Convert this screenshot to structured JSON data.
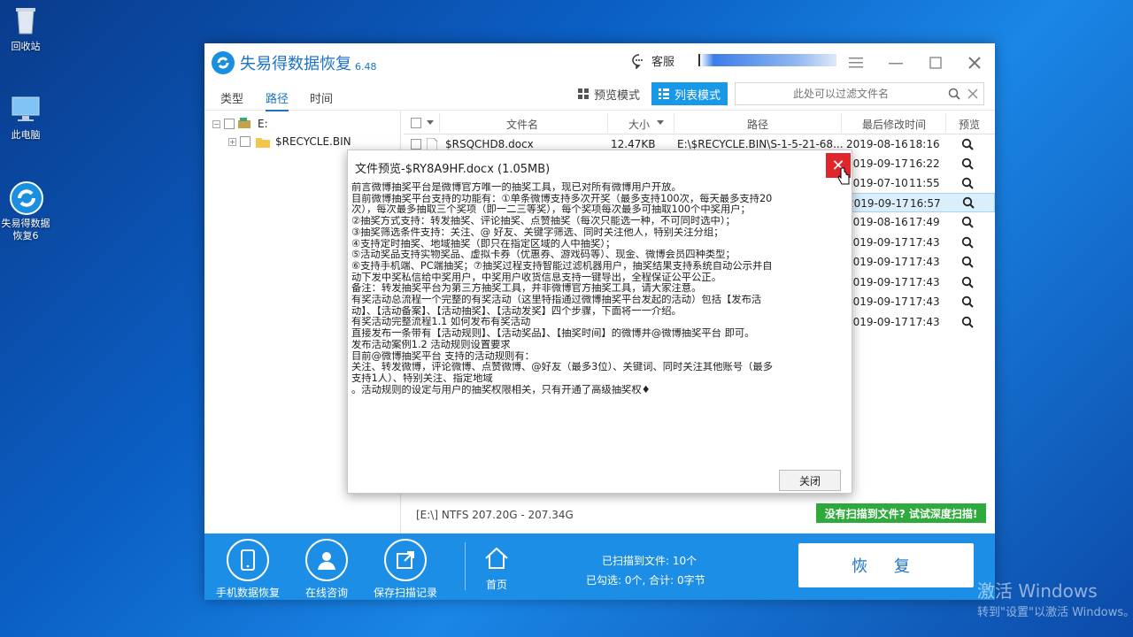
{
  "desktop": {
    "icons": [
      {
        "label": "回收站"
      },
      {
        "label": "此电脑"
      },
      {
        "label_line1": "失易得数据",
        "label_line2": "恢复6"
      }
    ],
    "watermark": {
      "line1": "激活 Windows",
      "line2": "转到\"设置\"以激活 Windows。"
    }
  },
  "app": {
    "name": "失易得数据恢复",
    "version": "6.48",
    "support_label": "客服"
  },
  "tabs": [
    {
      "label": "类型"
    },
    {
      "label": "路径"
    },
    {
      "label": "时间"
    }
  ],
  "view_modes": {
    "preview": "预览模式",
    "list": "列表模式"
  },
  "filter": {
    "placeholder": "此处可以过滤文件名"
  },
  "tree": {
    "drive": "E:",
    "child": "$RECYCLE.BIN"
  },
  "table": {
    "headers": {
      "name": "文件名",
      "size": "大小",
      "path": "路径",
      "modified": "最后修改时间",
      "preview": "预览"
    },
    "rows": [
      {
        "name": "$RSQCHD8.docx",
        "size": "12.47KB",
        "path": "E:\\$RECYCLE.BIN\\S-1-5-21-68...",
        "date": "2019-08-16",
        "time": "18:16"
      },
      {
        "name": "",
        "size": "",
        "path": "",
        "date": "2019-09-17",
        "time": "16:22"
      },
      {
        "name": "",
        "size": "",
        "path": "",
        "date": "2019-07-10",
        "time": "11:55"
      },
      {
        "name": "",
        "size": "",
        "path": "",
        "date": "2019-09-17",
        "time": "16:57"
      },
      {
        "name": "",
        "size": "",
        "path": "",
        "date": "2019-08-16",
        "time": "17:49"
      },
      {
        "name": "",
        "size": "",
        "path": "",
        "date": "2019-09-17",
        "time": "17:43"
      },
      {
        "name": "",
        "size": "",
        "path": "",
        "date": "2019-09-17",
        "time": "17:43"
      },
      {
        "name": "",
        "size": "",
        "path": "",
        "date": "2019-09-17",
        "time": "17:43"
      },
      {
        "name": "",
        "size": "",
        "path": "",
        "date": "2019-09-17",
        "time": "17:43"
      },
      {
        "name": "",
        "size": "",
        "path": "",
        "date": "2019-09-17",
        "time": "17:43"
      }
    ]
  },
  "status": {
    "disk": "[E:\\] NTFS 207.20G - 207.34G",
    "deep_scan": "没有扫描到文件? 试试深度扫描!"
  },
  "bottom": {
    "phone_recovery": "手机数据恢复",
    "consult": "在线咨询",
    "save_scan": "保存扫描记录",
    "home": "首页",
    "scanned": "已扫描到文件: 10个",
    "selected": "已勾选: 0个, 合计: 0字节",
    "recover": "恢 复"
  },
  "dialog": {
    "title": "文件预览-$RY8A9HF.docx (1.05MB)",
    "close_button": "关闭",
    "lines": [
      "前言微博抽奖平台是微博官方唯一的抽奖工具，现已对所有微博用户开放。",
      "目前微博抽奖平台支持的功能有：①单条微博支持多次开奖（最多支持100次，每天最多支持20",
      "次），每次最多抽取三个奖项（即一二三等奖），每个奖项每次最多可抽取100个中奖用户；",
      "②抽奖方式支持：转发抽奖、评论抽奖、点赞抽奖（每次只能选一种，不可同时选中）；",
      "③抽奖筛选条件支持：关注、@ 好友、关键字筛选、同时关注他人，特别关注分组；",
      "④支持定时抽奖、地域抽奖（即只在指定区域的人中抽奖）；",
      "⑤活动奖品支持实物奖品、虚拟卡券（优惠券、游戏码等）、现金、微博会员四种类型；",
      "⑥支持手机端、PC端抽奖；⑦抽奖过程支持智能过滤机器用户，抽奖结果支持系统自动公示并自",
      "动下发中奖私信给中奖用户，中奖用户收货信息支持一键导出，全程保证公平公正。",
      "备注：转发抽奖平台为第三方抽奖工具，并非微博官方抽奖工具，请大家注意。",
      "有奖活动总流程一个完整的有奖活动（这里特指通过微博抽奖平台发起的活动）包括【发布活",
      "动】、【活动备案】、【活动抽奖】、【活动发奖】四个步骤，下面将一一介绍。",
      "有奖活动完整流程1.1 如何发布有奖活动",
      "直接发布一条带有【活动规则】、【活动奖品】、【抽奖时间】的微博并@微博抽奖平台 即可。",
      "发布活动案例1.2 活动规则设置要求",
      "目前@微博抽奖平台 支持的活动规则有：",
      "关注、转发微博，评论微博、点赞微博、@好友（最多3位）、关键词、同时关注其他账号（最多",
      "支持1人）、特别关注、指定地域",
      "。活动规则的设定与用户的抽奖权限相关，只有开通了高级抽奖权♦"
    ]
  }
}
